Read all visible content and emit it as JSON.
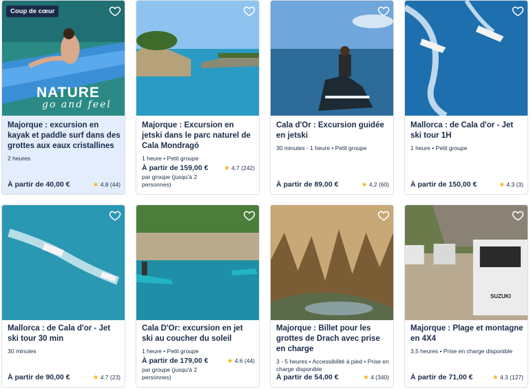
{
  "cards": [
    {
      "badge": "Coup de cœur",
      "title": "Majorque : excursion en kayak et paddle surf dans des grottes aux eaux cristallines",
      "meta": "2 heures",
      "price": "À partir de 40,00 €",
      "price_note": "",
      "rating": "4.8 (44)",
      "overlay_line1": "NATURE",
      "overlay_line2": "go and feel"
    },
    {
      "title": "Majorque : Excursion en jetski dans le parc naturel de Cala Mondragó",
      "meta": "1 heure • Petit groupe",
      "price": "À partir de 159,00 €",
      "price_note": "par groupe (jusqu'à 2 personnes)",
      "rating": "4.7 (242)"
    },
    {
      "title": "Cala d'Or : Excursion guidée en jetski",
      "meta": "30 minutes - 1 heure • Petit groupe",
      "price": "À partir de 89,00 €",
      "price_note": "",
      "rating": "4.2 (60)"
    },
    {
      "title": "Mallorca : de Cala d'or - Jet ski tour 1H",
      "meta": "1 heure • Petit groupe",
      "price": "À partir de 150,00 €",
      "price_note": "",
      "rating": "4.3 (3)"
    },
    {
      "title": "Mallorca : de Cala d'or - Jet ski tour 30 min",
      "meta": "30 minutes",
      "price": "À partir de 90,00 €",
      "price_note": "",
      "rating": "4.7 (23)"
    },
    {
      "title": "Cala D'Or: excursion en jet ski au coucher du soleil",
      "meta": "1 heure • Petit groupe",
      "price": "À partir de 179,00 €",
      "price_note": "par groupe (jusqu'à 2 personnes)",
      "rating": "4.6 (44)"
    },
    {
      "title": "Majorque : Billet pour les grottes de Drach avec prise en charge",
      "meta": "3 - 5 heures • Accessibilité à pied • Prise en charge disponible",
      "price": "À partir de 54,00 €",
      "price_note": "",
      "rating": "4 (340)"
    },
    {
      "title": "Majorque : Plage et montagne en 4X4",
      "meta": "3,5 heures • Prise en charge disponible",
      "price": "À partir de 71,00 €",
      "price_note": "",
      "rating": "4.3 (127)",
      "image_text": "SUZUKI"
    }
  ],
  "colors": {
    "star": "#f4b400",
    "text": "#1a2b49",
    "featured_bg": "#e3edfb"
  },
  "icons": {
    "favorite": "heart-outline-icon",
    "rating": "star-icon"
  }
}
